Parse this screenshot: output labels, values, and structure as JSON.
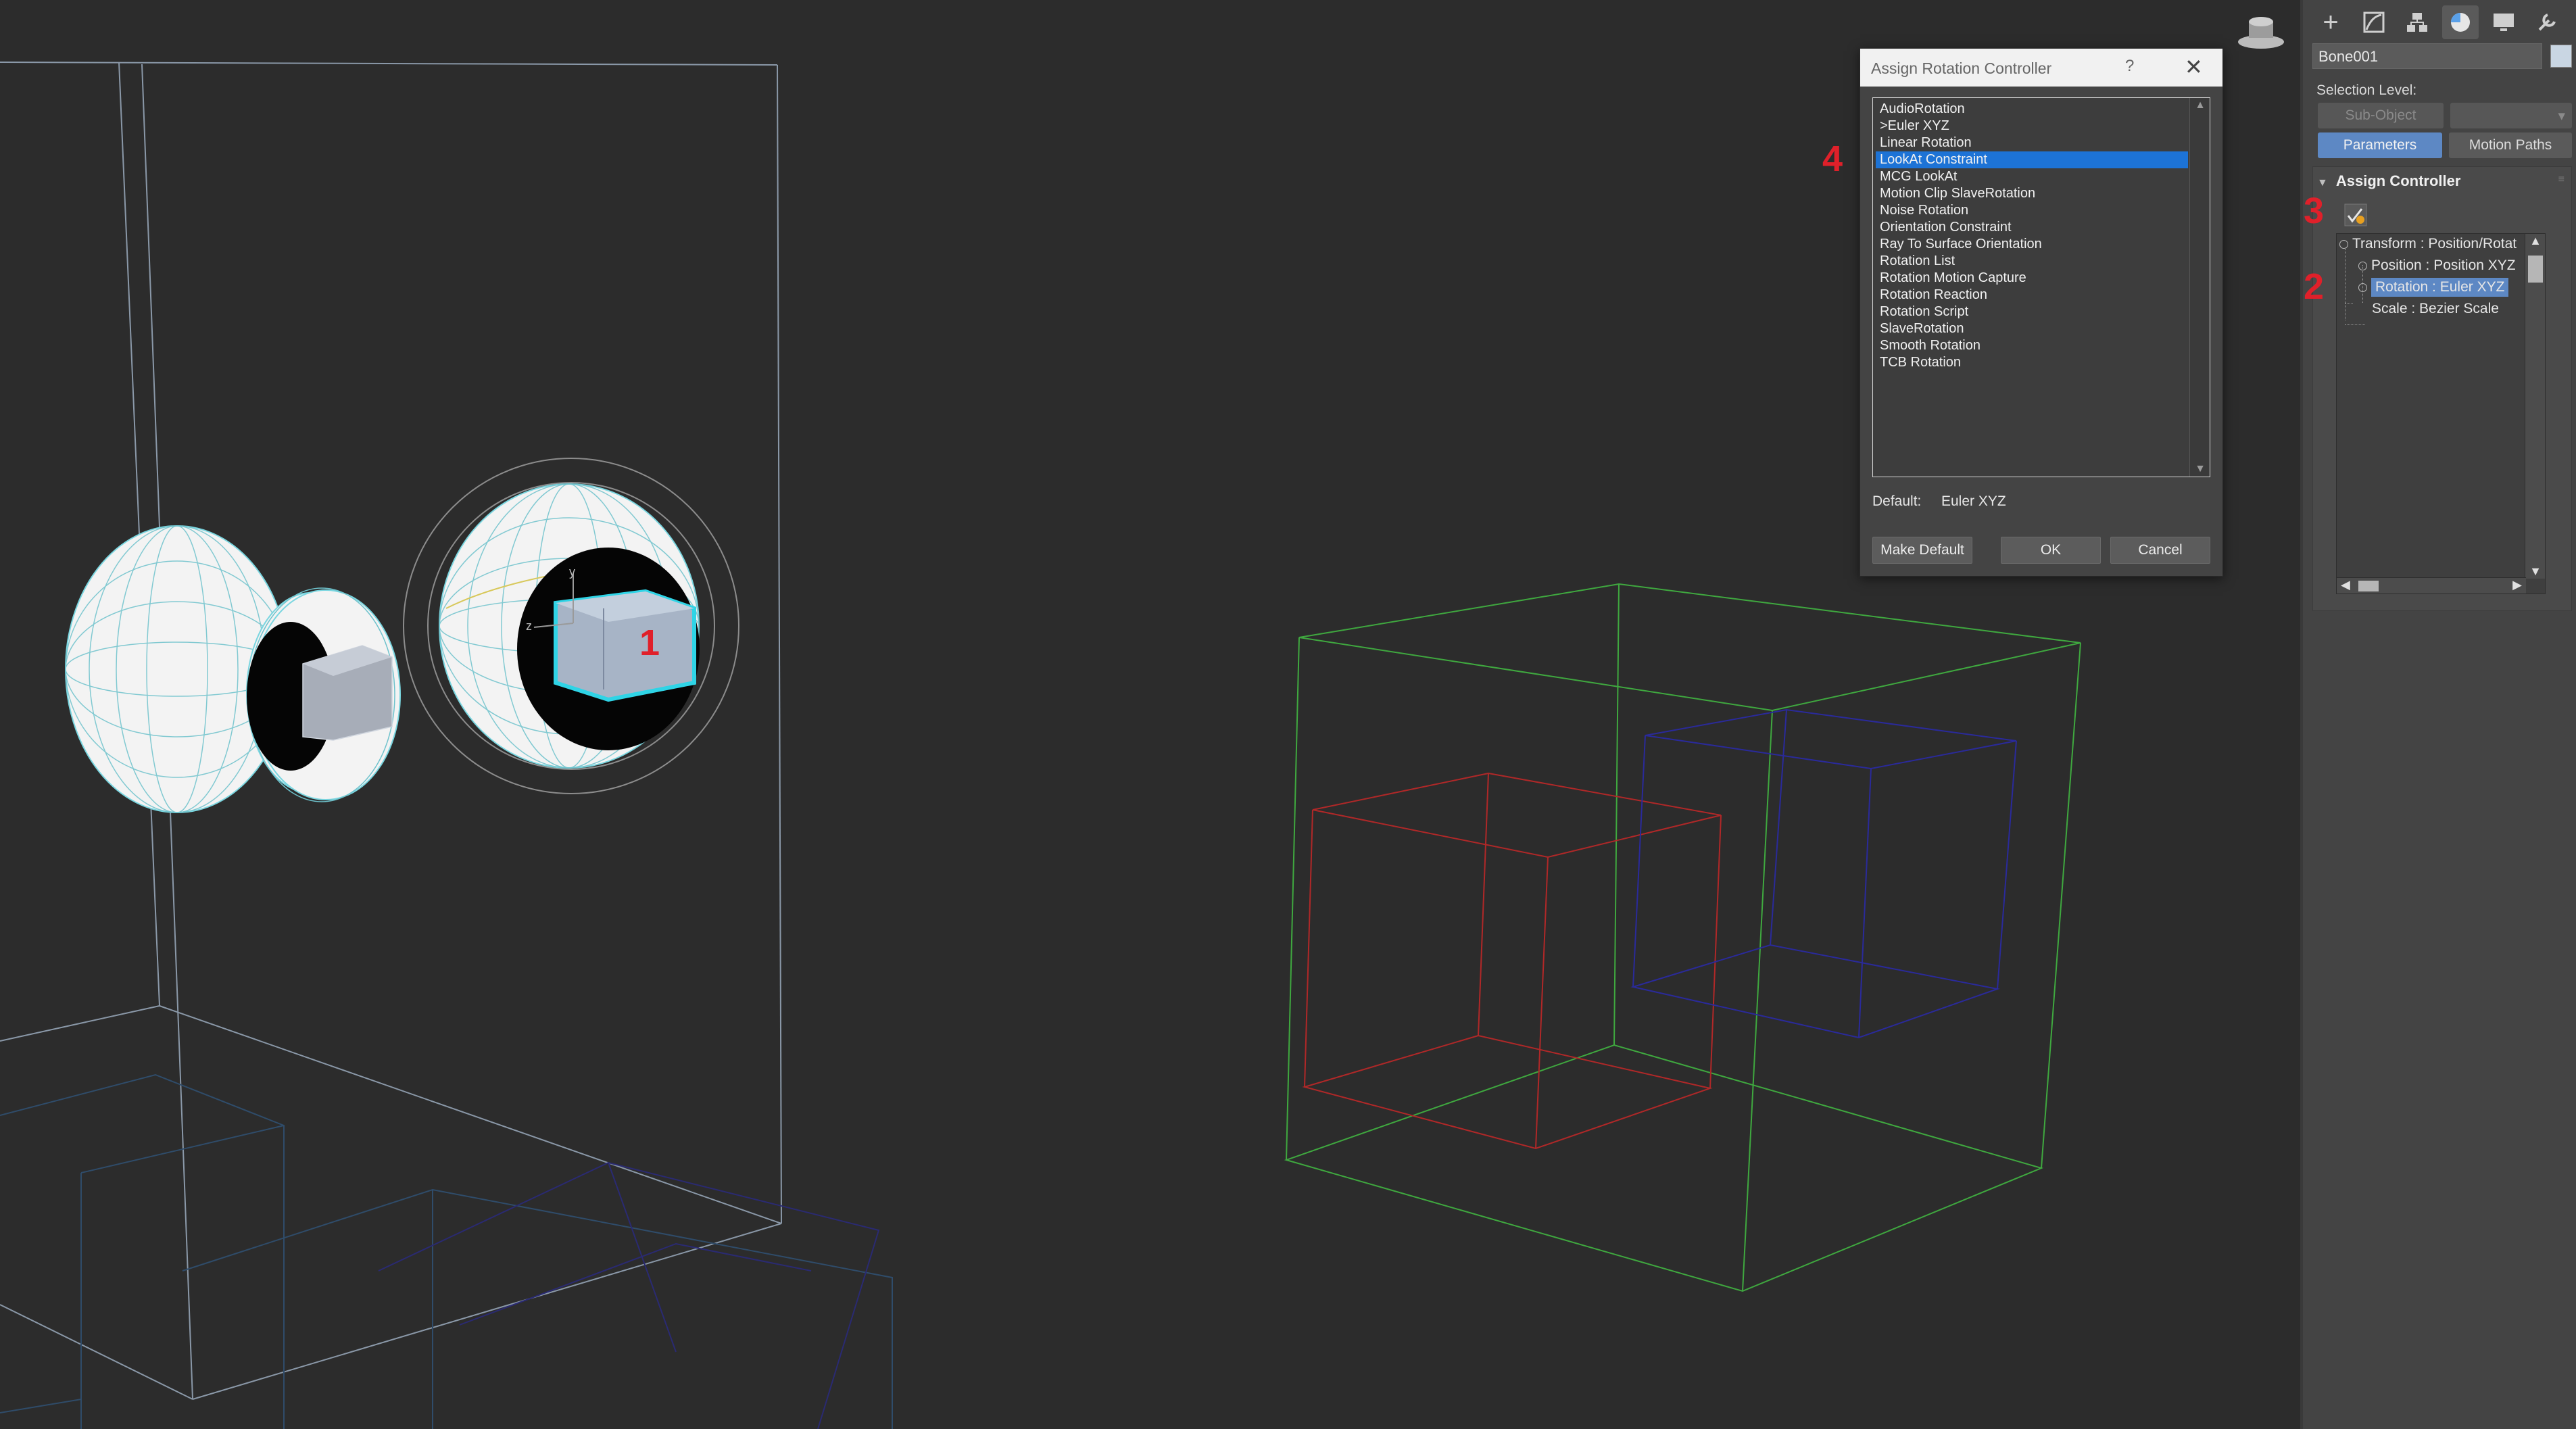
{
  "viewport": {
    "step_markers": [
      "1",
      "2",
      "3",
      "4"
    ]
  },
  "command_panel": {
    "tabs": [
      {
        "icon": "create-icon"
      },
      {
        "icon": "modify-icon"
      },
      {
        "icon": "hierarchy-icon"
      },
      {
        "icon": "motion-icon"
      },
      {
        "icon": "display-icon"
      },
      {
        "icon": "utilities-icon"
      }
    ],
    "object_name": "Bone001",
    "selection_level_label": "Selection Level:",
    "sub_object_label": "Sub-Object",
    "parameters_label": "Parameters",
    "motion_paths_label": "Motion Paths",
    "rollout_title": "Assign Controller",
    "tree": [
      {
        "label": "Transform : Position/Rotat",
        "expanded": true
      },
      {
        "label": "Position : Position XYZ"
      },
      {
        "label": "Rotation : Euler XYZ",
        "selected": true
      },
      {
        "label": "Scale : Bezier Scale"
      }
    ]
  },
  "dialog": {
    "title": "Assign Rotation Controller",
    "help": "?",
    "close": "✕",
    "items": [
      "AudioRotation",
      ">Euler XYZ",
      "Linear Rotation",
      "LookAt Constraint",
      "MCG LookAt",
      "Motion Clip SlaveRotation",
      "Noise Rotation",
      "Orientation Constraint",
      "Ray To Surface Orientation",
      "Rotation List",
      "Rotation Motion Capture",
      "Rotation Reaction",
      "Rotation Script",
      "SlaveRotation",
      "Smooth Rotation",
      "TCB Rotation"
    ],
    "selected_index": 3,
    "default_label": "Default:",
    "default_value": "Euler XYZ",
    "make_default_label": "Make Default",
    "ok_label": "OK",
    "cancel_label": "Cancel"
  },
  "colors": {
    "selection_blue": "#1d73d6",
    "panel_accent": "#5d88c4",
    "step_red": "#e0202a",
    "wire_green": "#3fa83f",
    "wire_red": "#b02828",
    "wire_blue": "#2a2a9a",
    "wire_cyan": "#5fd0e0"
  }
}
